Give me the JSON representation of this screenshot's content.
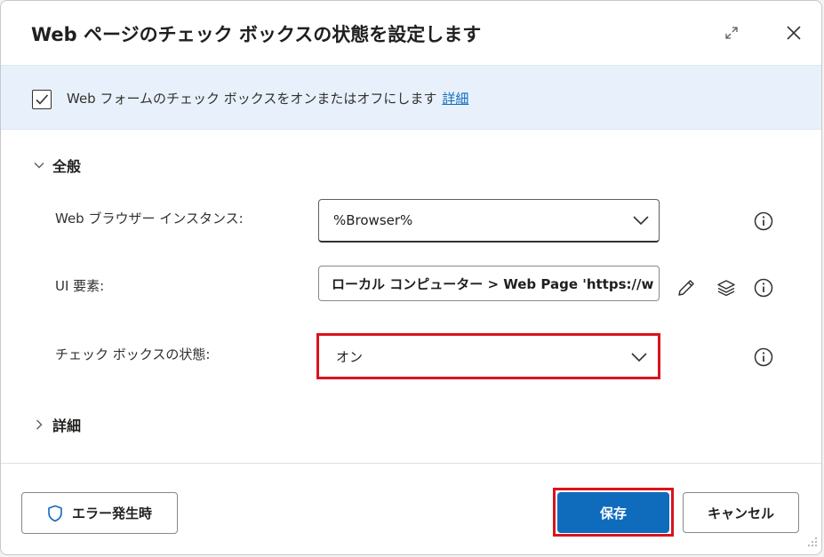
{
  "dialog": {
    "title": "Web ページのチェック ボックスの状態を設定します"
  },
  "banner": {
    "description": "Web フォームのチェック ボックスをオンまたはオフにします",
    "details_link": "詳細"
  },
  "sections": {
    "general": "全般",
    "advanced": "詳細"
  },
  "fields": {
    "browser_instance": {
      "label": "Web ブラウザー インスタンス:",
      "value": "%Browser%"
    },
    "ui_element": {
      "label": "UI 要素:",
      "value": "ローカル コンピューター > Web Page 'https://w"
    },
    "checkbox_state": {
      "label": "チェック ボックスの状態:",
      "value": "オン"
    }
  },
  "footer": {
    "on_error": "エラー発生時",
    "save": "保存",
    "cancel": "キャンセル"
  },
  "colors": {
    "accent": "#0f6cbd",
    "highlight": "#d9141b",
    "banner_bg": "#e8f1fb"
  }
}
